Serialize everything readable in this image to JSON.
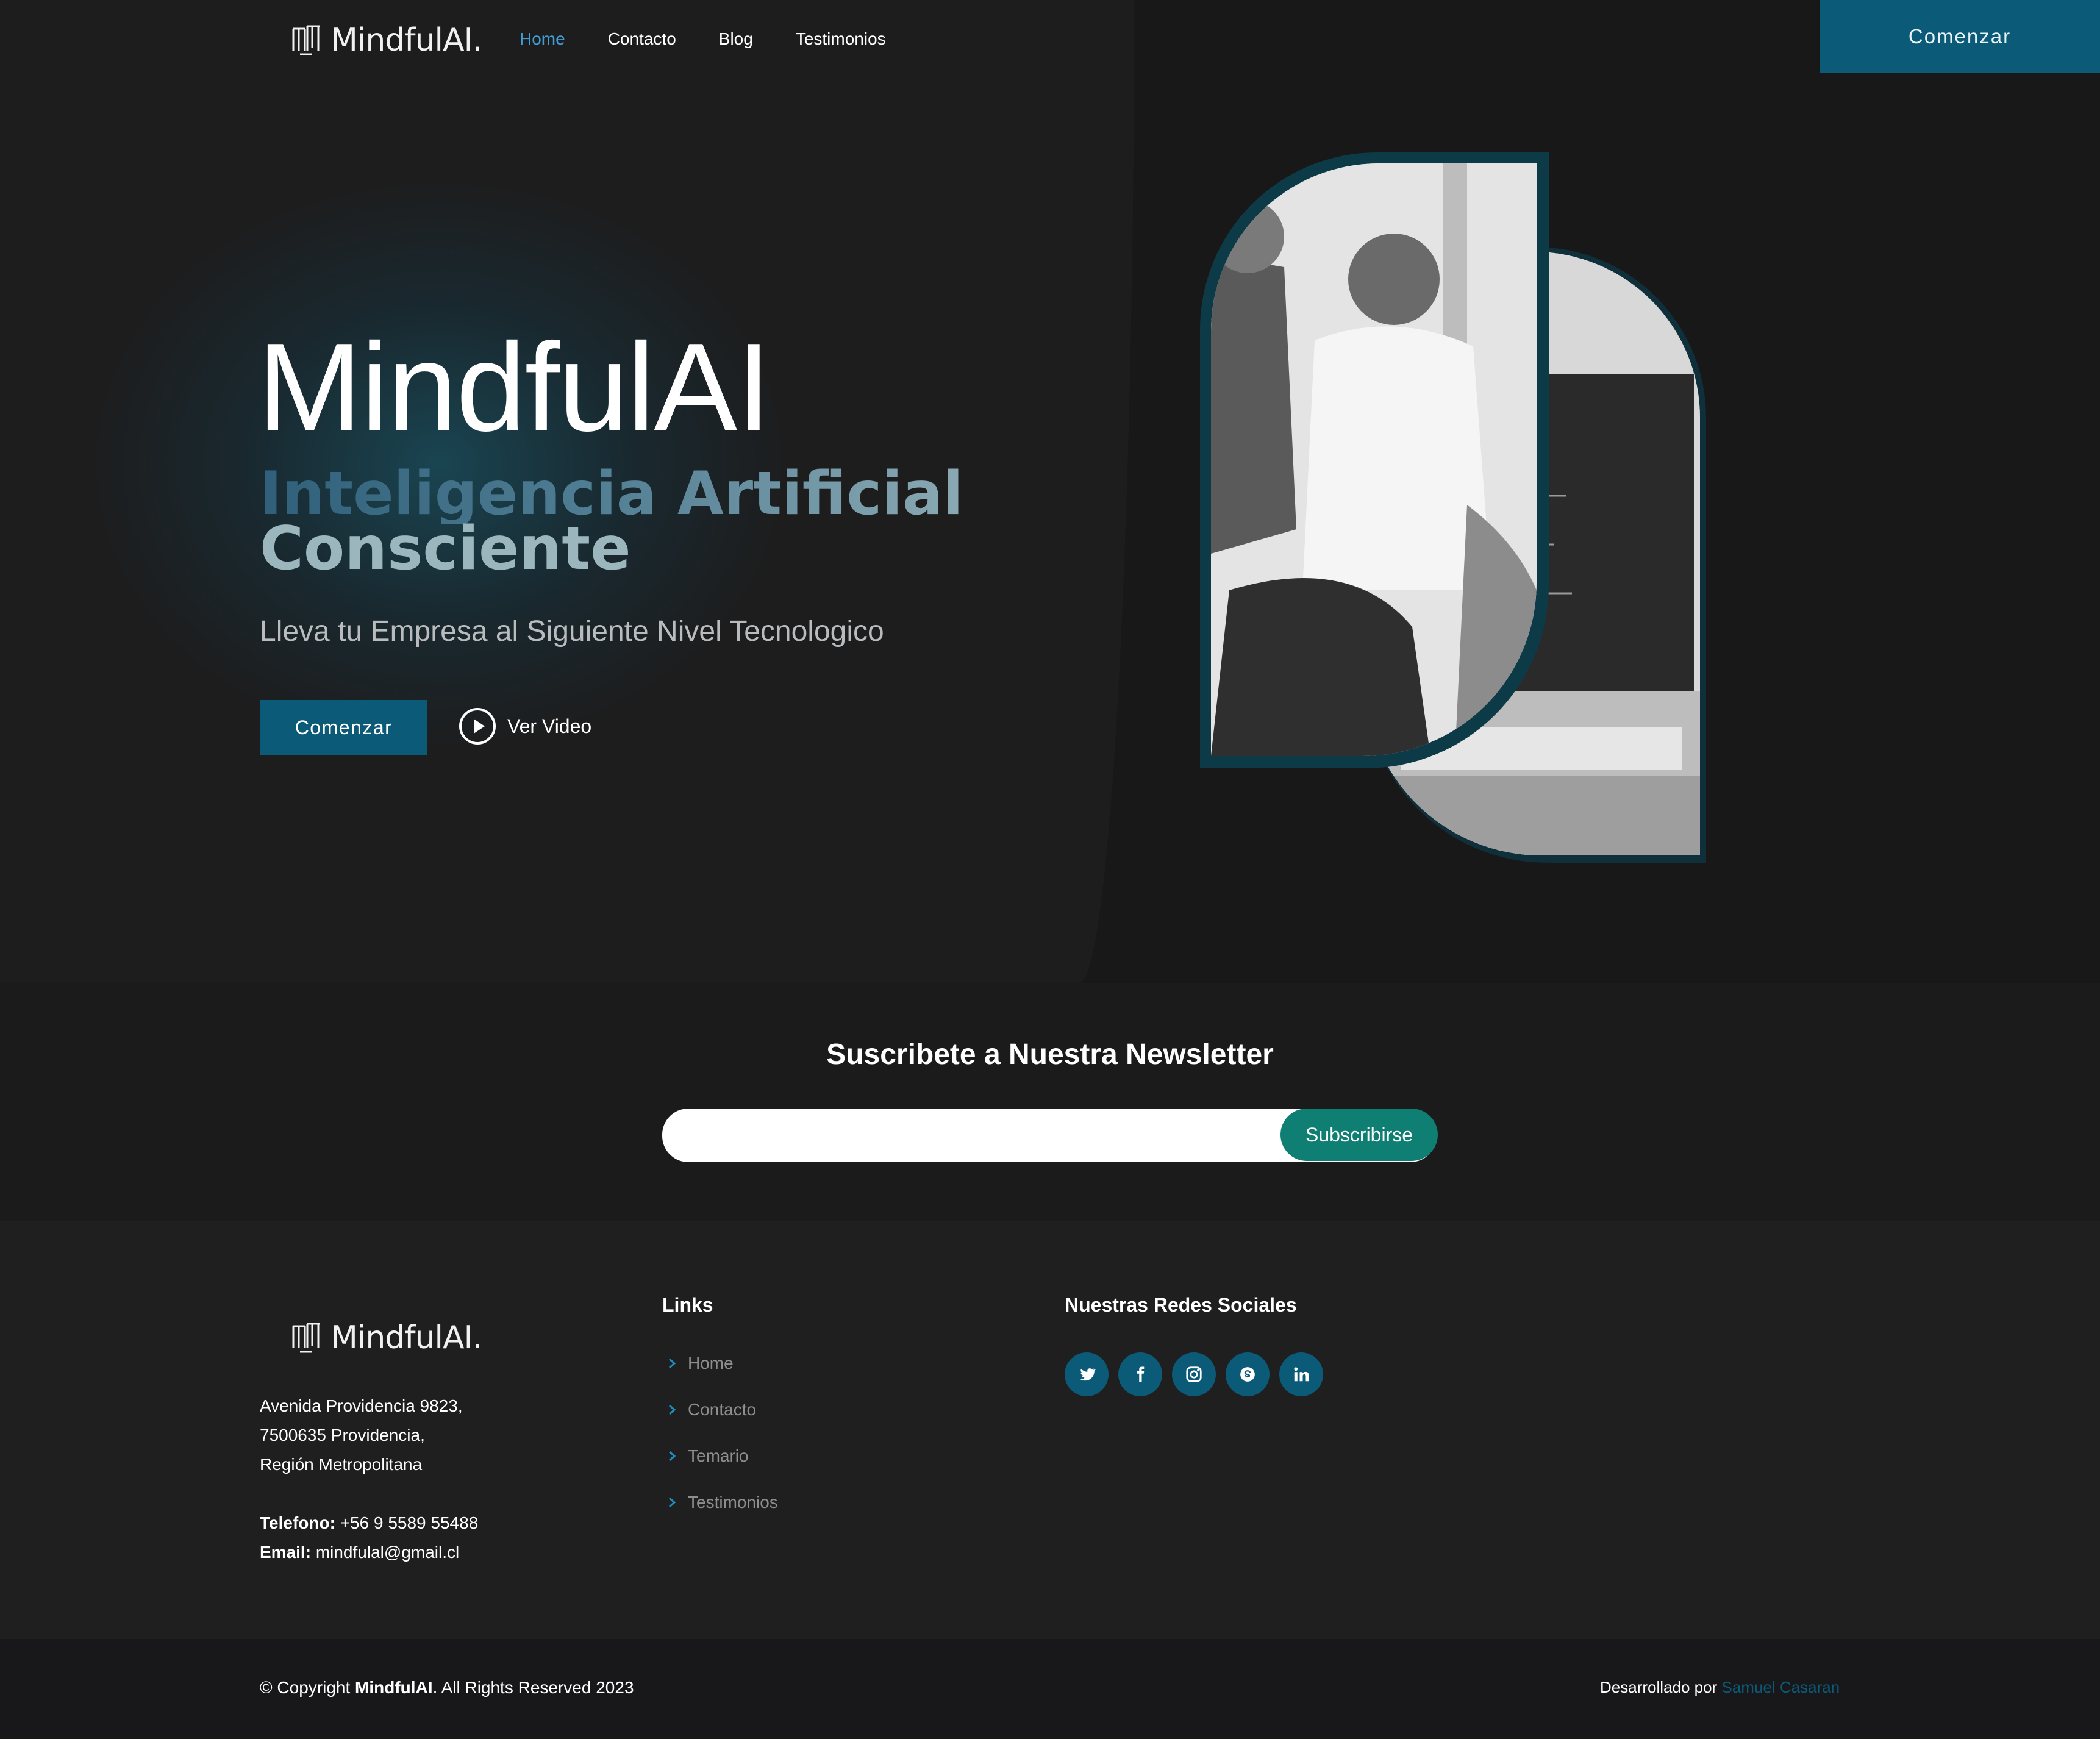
{
  "brand": {
    "name": "MindfulAI."
  },
  "nav": {
    "items": [
      {
        "label": "Home",
        "active": true
      },
      {
        "label": "Contacto",
        "active": false
      },
      {
        "label": "Blog",
        "active": false
      },
      {
        "label": "Testimonios",
        "active": false
      }
    ],
    "cta_label": "Comenzar"
  },
  "hero": {
    "title": "MindfulAI",
    "subtitle_line1": "Inteligencia Artificial",
    "subtitle_line2": "Consciente",
    "lead": "Lleva tu Empresa al Siguiente Nivel Tecnologico",
    "primary_button": "Comenzar",
    "video_link": "Ver Video"
  },
  "newsletter": {
    "title": "Suscribete a Nuestra Newsletter",
    "input_value": "",
    "button_label": "Subscribirse"
  },
  "footer": {
    "address_lines": [
      "Avenida Providencia 9823,",
      "7500635 Providencia,",
      "Región Metropolitana"
    ],
    "phone_label": "Telefono:",
    "phone": "+56 9 5589 55488",
    "email_label": "Email:",
    "email": "mindfulal@gmail.cl",
    "links_title": "Links",
    "links": [
      "Home",
      "Contacto",
      "Temario",
      "Testimonios"
    ],
    "social_title": "Nuestras Redes Sociales",
    "socials": [
      "twitter-icon",
      "facebook-icon",
      "instagram-icon",
      "skype-icon",
      "linkedin-icon"
    ]
  },
  "bottom": {
    "copyright_prefix": "© Copyright",
    "copyright_brand": "MindfulAI",
    "copyright_suffix": ". All Rights Reserved 2023",
    "dev_prefix": "Desarrollado por",
    "dev_name": "Samuel Casaran"
  },
  "colors": {
    "accent": "#0b5a78",
    "nav_active": "#3f9fd6",
    "subscribe": "#0e7f72",
    "background": "#1b1b1c"
  }
}
